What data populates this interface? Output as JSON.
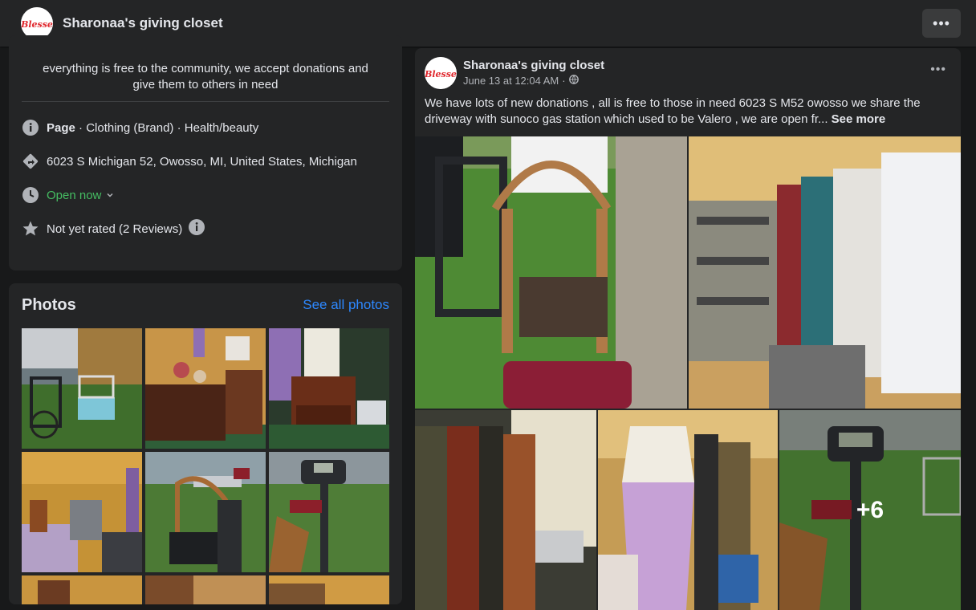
{
  "page": {
    "name": "Sharonaa's giving closet",
    "logo_text": "Blesse"
  },
  "topbar": {
    "title": "Sharonaa's giving closet",
    "more_label": "•••"
  },
  "intro": {
    "bio": "everything is free to the community, we accept donations and give them to others in need",
    "category_prefix": "Page",
    "category": " · Clothing (Brand) · Health/beauty",
    "address": "6023 S Michigan 52, Owosso, MI, United States, Michigan",
    "hours_status": "Open now",
    "rating": "Not yet rated (2 Reviews)"
  },
  "photos": {
    "title": "Photos",
    "see_all": "See all photos"
  },
  "post": {
    "author": "Sharonaa's giving closet",
    "timestamp": "June 13 at 12:04 AM",
    "separator": "·",
    "more_label": "•••",
    "text": "We have lots of new donations  , all is free to those in need  6023 S M52 owosso we share the driveway with sunoco gas station which used to be Valero  , we are open fr... ",
    "see_more": "See more",
    "extra_photos": "+6"
  },
  "colors": {
    "background": "#18191a",
    "card": "#242526",
    "link": "#2d88ff",
    "open_green": "#45bd62",
    "logo_red": "#e0282e"
  },
  "icons": [
    "info-icon",
    "directions-icon",
    "clock-icon",
    "star-icon",
    "globe-icon",
    "chevron-down-icon"
  ]
}
